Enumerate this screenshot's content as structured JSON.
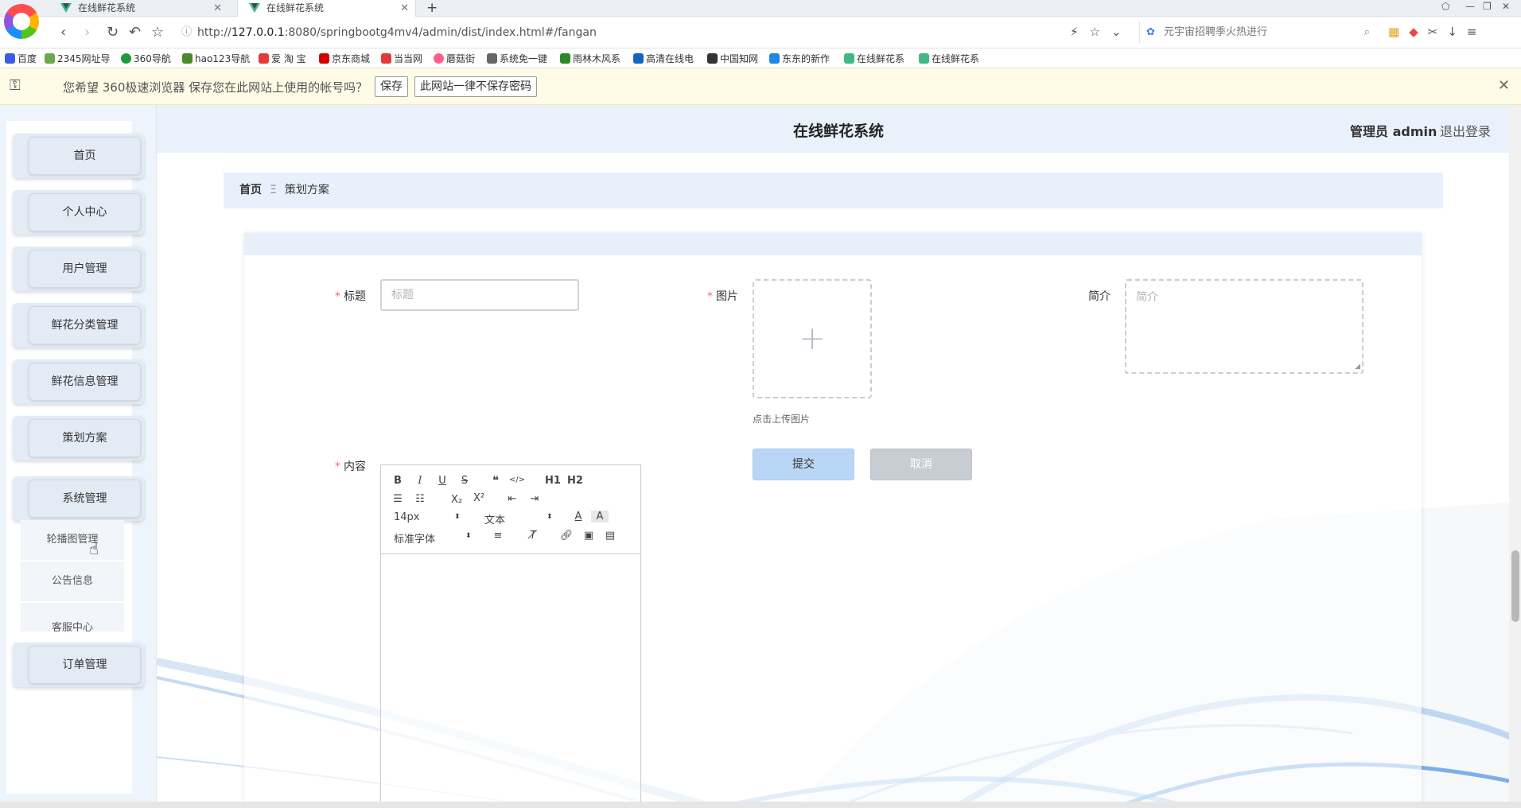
{
  "browser": {
    "tabs": [
      {
        "title": "在线鲜花系统",
        "active": false
      },
      {
        "title": "在线鲜花系统",
        "active": true
      }
    ],
    "url_prefix": "http://",
    "url_host": "127.0.0.1",
    "url_rest": ":8080/springbootg4mv4/admin/dist/index.html#/fangan",
    "search_placeholder": "元宇宙招聘季火热进行",
    "bookmarks": [
      "百度",
      "2345网址导",
      "360导航",
      "hao123导航",
      "爱 淘 宝",
      "京东商城",
      "当当网",
      "蘑菇街",
      "系统免一键",
      "雨林木风系",
      "高清在线电",
      "中国知网",
      "东东的新作",
      "在线鲜花系",
      "在线鲜花系"
    ],
    "password_prompt": {
      "message": "您希望 360极速浏览器 保存您在此网站上使用的帐号吗？",
      "save_label": "保存",
      "never_label": "此网站一律不保存密码"
    }
  },
  "app": {
    "title": "在线鲜花系统",
    "admin_label": "管理员 admin",
    "logout_label": "退出登录"
  },
  "sidebar": {
    "items": [
      {
        "label": "首页"
      },
      {
        "label": "个人中心"
      },
      {
        "label": "用户管理"
      },
      {
        "label": "鲜花分类管理"
      },
      {
        "label": "鲜花信息管理"
      },
      {
        "label": "策划方案"
      },
      {
        "label": "系统管理"
      },
      {
        "label": "订单管理"
      }
    ],
    "submenu": [
      {
        "label": "轮播图管理"
      },
      {
        "label": "公告信息"
      },
      {
        "label": "客服中心"
      }
    ]
  },
  "breadcrumb": {
    "home": "首页",
    "separator": "Ξ",
    "current": "策划方案"
  },
  "form": {
    "title_label": "标题",
    "title_placeholder": "标题",
    "image_label": "图片",
    "upload_hint": "点击上传图片",
    "intro_label": "简介",
    "intro_placeholder": "简介",
    "content_label": "内容",
    "submit_label": "提交",
    "cancel_label": "取消"
  },
  "editor": {
    "font_size": "14px",
    "header": "文本",
    "font_family": "标准字体",
    "tools_row1": [
      "B",
      "I",
      "U",
      "S",
      "❝",
      "</>",
      "H1",
      "H2"
    ],
    "tools_row2": [
      "ordered-list",
      "bullet-list",
      "X₂",
      "X²",
      "outdent",
      "indent"
    ]
  },
  "colors": {
    "accent": "#b9d6f7",
    "required": "#f56c6c",
    "header_bg": "#e9f1fa"
  }
}
